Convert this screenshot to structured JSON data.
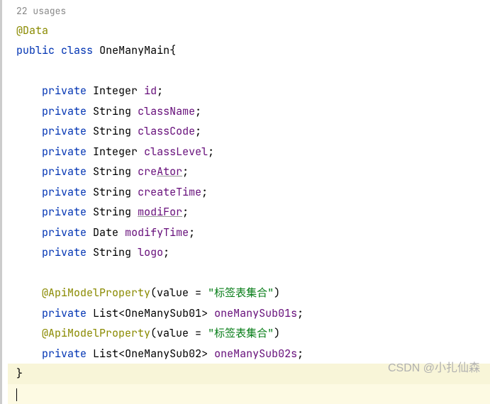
{
  "usages": "22 usages",
  "code": {
    "annotation1": "@Data",
    "kw_public": "public",
    "kw_class": "class",
    "class_name": "OneManyMain",
    "brace_open": "{",
    "kw_private": "private",
    "type_integer": "Integer",
    "type_string": "String",
    "type_date": "Date",
    "type_list": "List",
    "field_id": "id",
    "field_className": "className",
    "field_classCode": "classCode",
    "field_classLevel": "classLevel",
    "field_creator_pre": "cre",
    "field_creator_mid": "Ator",
    "field_createTime": "createTime",
    "field_modiFor": "modiFor",
    "field_modifyTime": "modifyTime",
    "field_logo": "logo",
    "annotation2": "@ApiModelProperty",
    "value_eq": "value = ",
    "string_label": "\"标签表集合\"",
    "generic1": "OneManySub01",
    "field_sub01s": "oneManySub01s",
    "generic2": "OneManySub02",
    "field_sub02s": "oneManySub02s",
    "brace_close": "}",
    "semi": ";"
  },
  "watermark": "CSDN @小扎仙森"
}
